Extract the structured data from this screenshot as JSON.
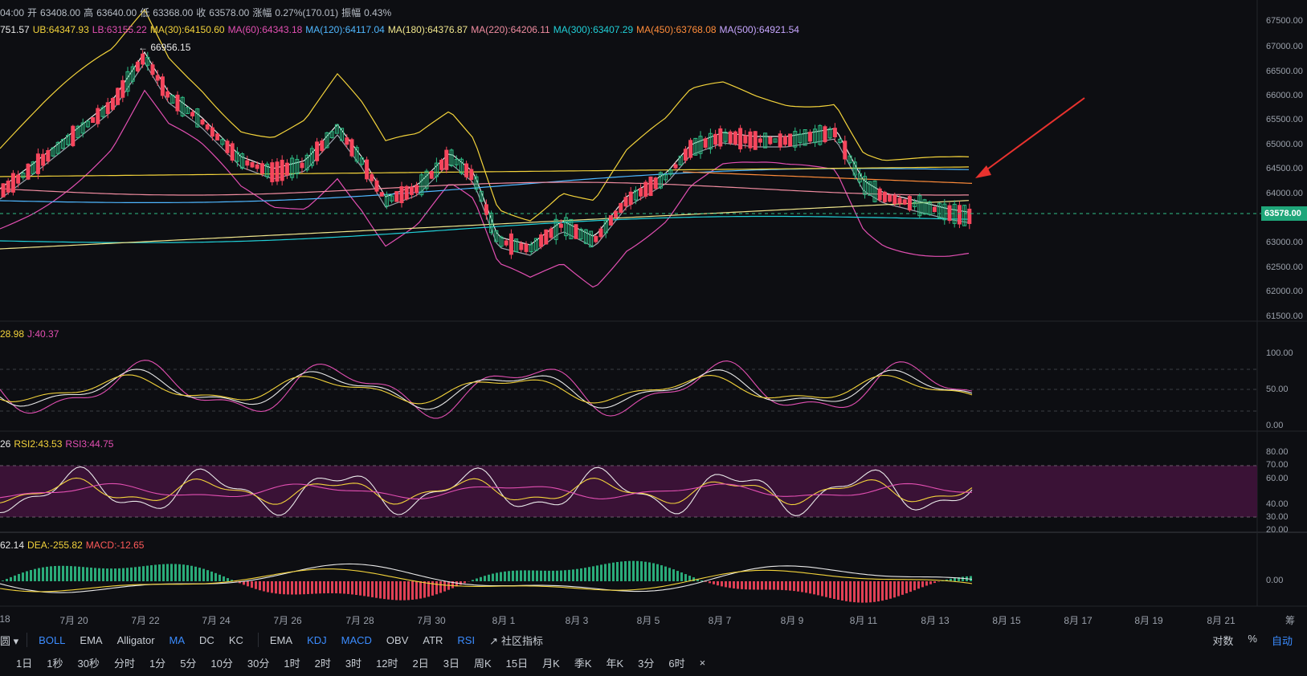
{
  "header": {
    "ohlc": [
      {
        "k": "time",
        "v": "04:00",
        "color": "#b7bdc6"
      },
      {
        "k": "open_label",
        "v": "开",
        "color": "#b7bdc6"
      },
      {
        "k": "open",
        "v": "63408.00",
        "color": "#b7bdc6"
      },
      {
        "k": "high_label",
        "v": "高",
        "color": "#b7bdc6"
      },
      {
        "k": "high",
        "v": "63640.00",
        "color": "#b7bdc6"
      },
      {
        "k": "low_label",
        "v": "低",
        "color": "#b7bdc6"
      },
      {
        "k": "low",
        "v": "63368.00",
        "color": "#b7bdc6"
      },
      {
        "k": "close_label",
        "v": "收",
        "color": "#b7bdc6"
      },
      {
        "k": "close",
        "v": "63578.00",
        "color": "#b7bdc6"
      },
      {
        "k": "change_label",
        "v": "涨幅",
        "color": "#b7bdc6"
      },
      {
        "k": "change",
        "v": "0.27%(170.01)",
        "color": "#b7bdc6"
      },
      {
        "k": "amp_label",
        "v": "振幅",
        "color": "#b7bdc6"
      },
      {
        "k": "amp",
        "v": "0.43%",
        "color": "#b7bdc6"
      }
    ],
    "boll": [
      {
        "t": "751.57",
        "color": "#e9e9e9"
      },
      {
        "t": "UB:64347.93",
        "color": "#f3d33b"
      },
      {
        "t": "LB:63155.22",
        "color": "#e24fb2"
      }
    ],
    "ma": [
      {
        "t": "MA(30):64150.60",
        "color": "#f3d33b"
      },
      {
        "t": "MA(60):64343.18",
        "color": "#e24fb2"
      },
      {
        "t": "MA(120):64117.04",
        "color": "#4fb7ff"
      },
      {
        "t": "MA(180):64376.87",
        "color": "#f0e68c"
      },
      {
        "t": "MA(220):64206.11",
        "color": "#f08ca0"
      },
      {
        "t": "MA(300):63407.29",
        "color": "#20d0d8"
      },
      {
        "t": "MA(450):63768.08",
        "color": "#ff8c3a"
      },
      {
        "t": "MA(500):64921.54",
        "color": "#c7a6ff"
      }
    ],
    "max_marker": "← 66956.15"
  },
  "kdj_header": [
    {
      "t": "28.98",
      "color": "#f3d33b"
    },
    {
      "t": "J:40.37",
      "color": "#e24fb2"
    }
  ],
  "rsi_header": [
    {
      "t": "26",
      "color": "#e9e9e9"
    },
    {
      "t": "RSI2:43.53",
      "color": "#f3d33b"
    },
    {
      "t": "RSI3:44.75",
      "color": "#e24fb2"
    }
  ],
  "macd_header": [
    {
      "t": "62.14",
      "color": "#e9e9e9"
    },
    {
      "t": "DEA:-255.82",
      "color": "#f3d33b"
    },
    {
      "t": "MACD:-12.65",
      "color": "#ff5a5a"
    }
  ],
  "price_axis": [
    "67500.00",
    "67000.00",
    "66500.00",
    "66000.00",
    "65500.00",
    "65000.00",
    "64500.00",
    "64000.00",
    "63500.00",
    "63000.00",
    "62500.00",
    "62000.00",
    "61500.00"
  ],
  "current_price": "63578.00",
  "kdj_axis": [
    "100.00",
    "50.00",
    "0.00"
  ],
  "rsi_axis": [
    "80.00",
    "70.00",
    "60.00",
    "40.00",
    "30.00",
    "20.00"
  ],
  "macd_axis": [
    "0.00"
  ],
  "date_axis": [
    "18",
    "7月 20",
    "7月 22",
    "7月 24",
    "7月 26",
    "7月 28",
    "7月 30",
    "8月 1",
    "8月 3",
    "8月 5",
    "8月 7",
    "8月 9",
    "8月 11",
    "8月 13",
    "8月 15",
    "8月 17",
    "8月 19",
    "8月 21"
  ],
  "date_axis_right": "筹",
  "indicators_bar": {
    "left_label": "圆",
    "items": [
      {
        "label": "BOLL",
        "active": true
      },
      {
        "label": "EMA",
        "active": false
      },
      {
        "label": "Alligator",
        "active": false
      },
      {
        "label": "MA",
        "active": true
      },
      {
        "label": "DC",
        "active": false
      },
      {
        "label": "KC",
        "active": false
      }
    ],
    "items2": [
      {
        "label": "EMA",
        "active": false
      },
      {
        "label": "KDJ",
        "active": true
      },
      {
        "label": "MACD",
        "active": true
      },
      {
        "label": "OBV",
        "active": false
      },
      {
        "label": "ATR",
        "active": false
      },
      {
        "label": "RSI",
        "active": true
      }
    ],
    "community": "社区指标",
    "right": [
      {
        "label": "对数",
        "active": false
      },
      {
        "label": "%",
        "active": false
      },
      {
        "label": "自动",
        "active": true
      }
    ]
  },
  "interval_bar": [
    "1日",
    "1秒",
    "30秒",
    "分时",
    "1分",
    "5分",
    "10分",
    "30分",
    "1时",
    "2时",
    "3时",
    "12时",
    "2日",
    "3日",
    "周K",
    "15日",
    "月K",
    "季K",
    "年K",
    "3分",
    "6时",
    "×"
  ],
  "colors": {
    "up": "#2ebd85",
    "down": "#f6465d",
    "accent": "#3b8cff",
    "bg": "#0d0e12",
    "rsi_band": "#3a1236"
  }
}
